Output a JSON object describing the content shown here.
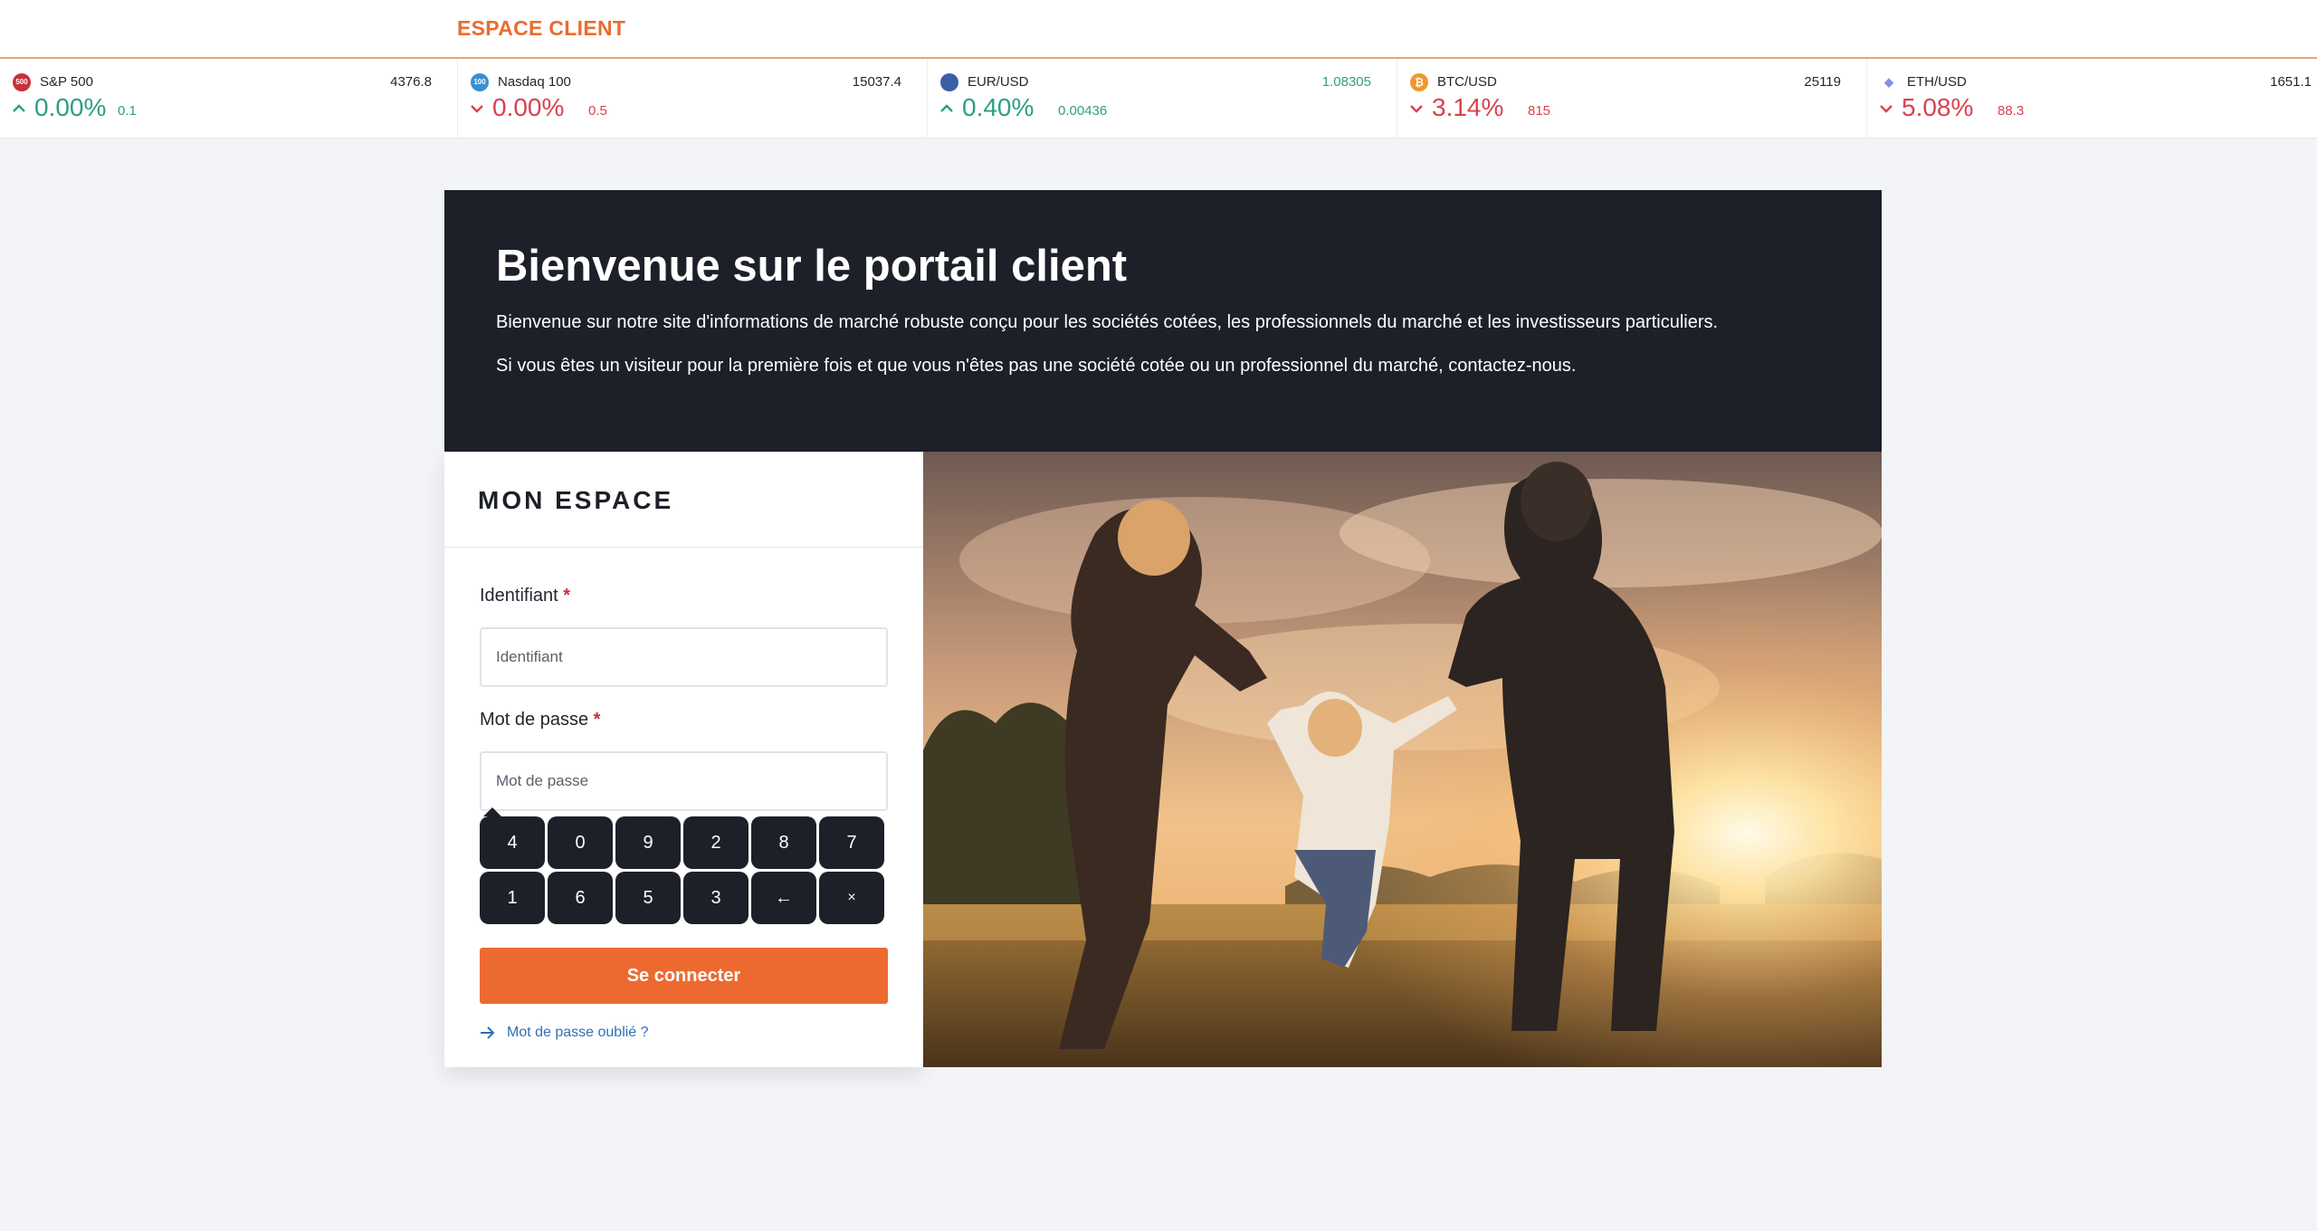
{
  "header": {
    "brand": "ESPACE CLIENT"
  },
  "ticker": [
    {
      "name": "S&P 500",
      "icon_text": "500",
      "icon_color": "#c9303e",
      "price": "4376.8",
      "price_trend": "neutral",
      "direction": "up",
      "percent": "0.00%",
      "delta": "0.1",
      "trend": "up"
    },
    {
      "name": "Nasdaq 100",
      "icon_text": "100",
      "icon_color": "#3a8fd1",
      "price": "15037.4",
      "price_trend": "neutral",
      "direction": "down",
      "percent": "0.00%",
      "delta": "0.5",
      "trend": "down"
    },
    {
      "name": "EUR/USD",
      "icon_text": "",
      "icon_color": "#3b5ea8",
      "price": "1.08305",
      "price_trend": "up",
      "direction": "up",
      "percent": "0.40%",
      "delta": "0.00436",
      "trend": "up"
    },
    {
      "name": "BTC/USD",
      "icon_text": "₿",
      "icon_color": "#f0982f",
      "price": "25119",
      "price_trend": "neutral",
      "direction": "down",
      "percent": "3.14%",
      "delta": "815",
      "trend": "down"
    },
    {
      "name": "ETH/USD",
      "icon_text": "◆",
      "icon_color": "#8a8fe6",
      "price": "1651.1",
      "price_trend": "neutral",
      "direction": "down",
      "percent": "5.08%",
      "delta": "88.3",
      "trend": "down"
    }
  ],
  "hero": {
    "title": "Bienvenue sur le portail client",
    "text1": "Bienvenue sur notre site d'informations de marché robuste conçu pour les sociétés cotées, les professionnels du marché et les investisseurs particuliers.",
    "text2": "Si vous êtes un visiteur pour la première fois et que vous n'êtes pas une société cotée ou un professionnel du marché, contactez-nous."
  },
  "login": {
    "title": "MON ESPACE",
    "username_label": "Identifiant",
    "username_placeholder": "Identifiant",
    "username_value": "",
    "password_label": "Mot de passe",
    "password_placeholder": "Mot de passe",
    "password_value": "",
    "required_marker": "*",
    "keypad_row1": [
      "4",
      "0",
      "9",
      "2",
      "8",
      "7"
    ],
    "keypad_row2": [
      "1",
      "6",
      "5",
      "3",
      "←",
      "×"
    ],
    "submit_label": "Se connecter",
    "forgot_label": "Mot de passe oublié ?"
  },
  "colors": {
    "accent": "#ec6a30",
    "dark": "#1d2029",
    "up": "#2e9e83",
    "down": "#d8424f",
    "link": "#2f6fb5"
  }
}
